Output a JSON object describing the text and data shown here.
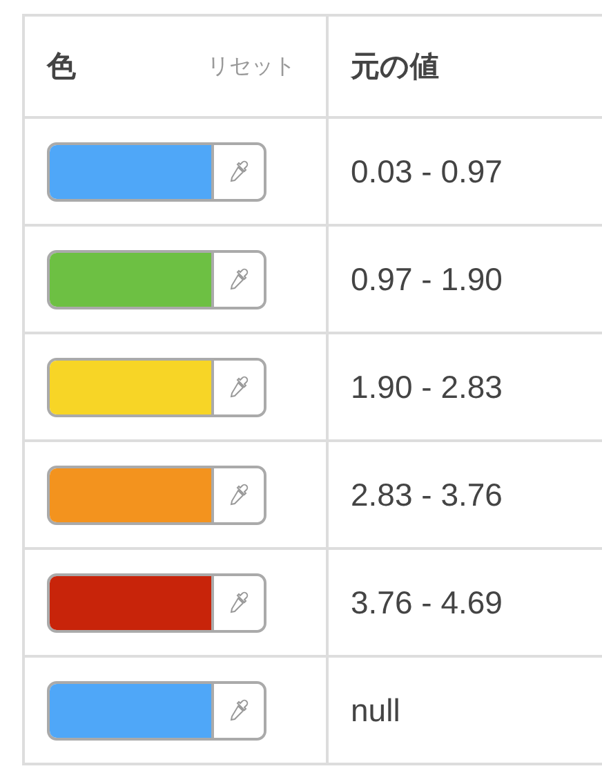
{
  "table": {
    "columns": [
      {
        "label": "色",
        "action": "リセット"
      },
      {
        "label": "元の値"
      }
    ],
    "rows": [
      {
        "color": "#4fa7f8",
        "value": "0.03 - 0.97"
      },
      {
        "color": "#6dc043",
        "value": "0.97 - 1.90"
      },
      {
        "color": "#f7d526",
        "value": "1.90 - 2.83"
      },
      {
        "color": "#f3931e",
        "value": "2.83 - 3.76"
      },
      {
        "color": "#c8240a",
        "value": "3.76 - 4.69"
      },
      {
        "color": "#4fa7f8",
        "value": "null"
      }
    ]
  }
}
